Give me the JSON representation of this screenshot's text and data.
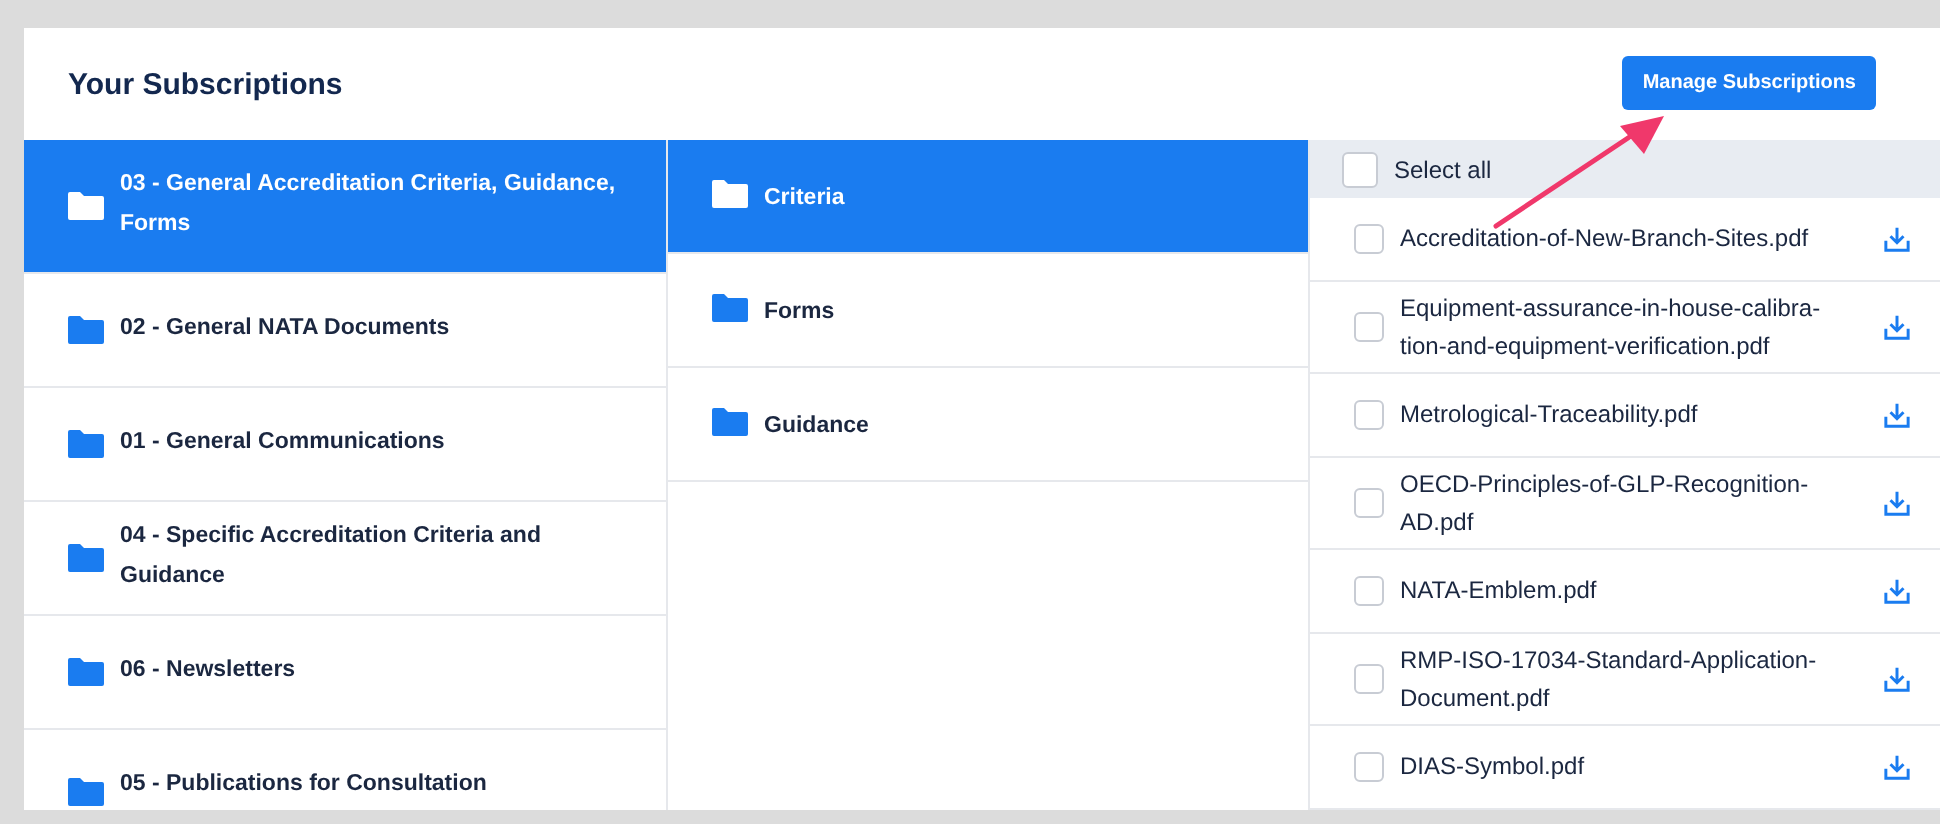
{
  "panel": {
    "title": "Your Subscriptions",
    "button": "Manage Subscriptions"
  },
  "folders": [
    {
      "label": "03 - General Accreditation Criteria, Guidance, Forms",
      "selected": true
    },
    {
      "label": "02 - General NATA Documents",
      "selected": false
    },
    {
      "label": "01 - General Communications",
      "selected": false
    },
    {
      "label": "04 - Specific Accreditation Criteria and Guidance",
      "selected": false
    },
    {
      "label": "06 - Newsletters",
      "selected": false
    },
    {
      "label": "05 - Publications for Consultation",
      "selected": false
    }
  ],
  "subfolders": [
    {
      "label": "Criteria",
      "selected": true
    },
    {
      "label": "Forms",
      "selected": false
    },
    {
      "label": "Guidance",
      "selected": false
    }
  ],
  "select_all": {
    "label": "Select all",
    "checked": false
  },
  "files": [
    {
      "name": "Accreditation-of-New-Branch-Sites.pdf",
      "checked": false
    },
    {
      "name": "Equipment-assurance-in-house-calibra-tion-and-equipment-verification.pdf",
      "checked": false
    },
    {
      "name": "Metrological-Traceability.pdf",
      "checked": false
    },
    {
      "name": "OECD-Principles-of-GLP-Recognition-AD.pdf",
      "checked": false
    },
    {
      "name": "NATA-Emblem.pdf",
      "checked": false
    },
    {
      "name": "RMP-ISO-17034-Standard-Application-Document.pdf",
      "checked": false
    },
    {
      "name": "DIAS-Symbol.pdf",
      "checked": false
    }
  ]
}
